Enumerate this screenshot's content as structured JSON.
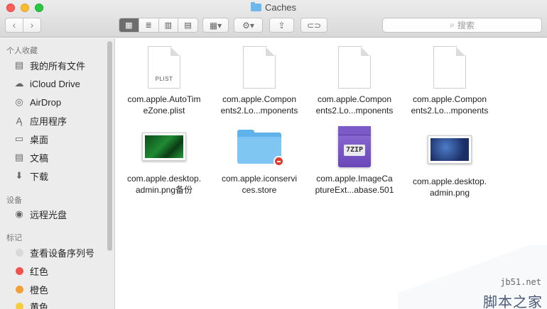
{
  "window": {
    "title": "Caches"
  },
  "toolbar": {
    "back_icon": "‹",
    "forward_icon": "›",
    "view_icons": [
      "▦",
      "≣",
      "▥",
      "▤"
    ],
    "arrange_icon": "▦▾",
    "action_icon": "⚙▾",
    "share_icon": "⇪",
    "tag_icon": "⊂⊃",
    "search_placeholder": "搜索"
  },
  "sidebar": {
    "favorites_heading": "个人收藏",
    "favorites": [
      {
        "label": "我的所有文件",
        "icon": "all-files-icon"
      },
      {
        "label": "iCloud Drive",
        "icon": "cloud-icon"
      },
      {
        "label": "AirDrop",
        "icon": "airdrop-icon"
      },
      {
        "label": "应用程序",
        "icon": "applications-icon"
      },
      {
        "label": "桌面",
        "icon": "desktop-icon"
      },
      {
        "label": "文稿",
        "icon": "documents-icon"
      },
      {
        "label": "下载",
        "icon": "downloads-icon"
      }
    ],
    "devices_heading": "设备",
    "devices": [
      {
        "label": "远程光盘",
        "icon": "remote-disc-icon"
      }
    ],
    "tags_heading": "标记",
    "tags": [
      {
        "label": "查看设备序列号",
        "color": "#d9d9d9"
      },
      {
        "label": "红色",
        "color": "#f0524c"
      },
      {
        "label": "橙色",
        "color": "#f5a034"
      },
      {
        "label": "黄色",
        "color": "#f7cd3a"
      }
    ]
  },
  "files": [
    {
      "name_line1": "com.apple.AutoTim",
      "name_line2": "eZone.plist",
      "kind": "plist",
      "doc_label": "PLIST"
    },
    {
      "name_line1": "com.apple.Compon",
      "name_line2": "ents2.Lo...mponents",
      "kind": "doc"
    },
    {
      "name_line1": "com.apple.Compon",
      "name_line2": "ents2.Lo...mponents",
      "kind": "doc"
    },
    {
      "name_line1": "com.apple.Compon",
      "name_line2": "ents2.Lo...mponents",
      "kind": "doc"
    },
    {
      "name_line1": "com.apple.desktop.",
      "name_line2": "admin.png备份",
      "kind": "image-green"
    },
    {
      "name_line1": "com.apple.iconservi",
      "name_line2": "ces.store",
      "kind": "folder"
    },
    {
      "name_line1": "com.apple.ImageCa",
      "name_line2": "ptureExt...abase.501",
      "kind": "zip",
      "zip_label": "7ZIP"
    },
    {
      "name_line1": "com.apple.desktop.",
      "name_line2": "admin.png",
      "kind": "image-blue"
    }
  ],
  "watermark": {
    "url": "jb51.net",
    "text": "脚本之家"
  }
}
